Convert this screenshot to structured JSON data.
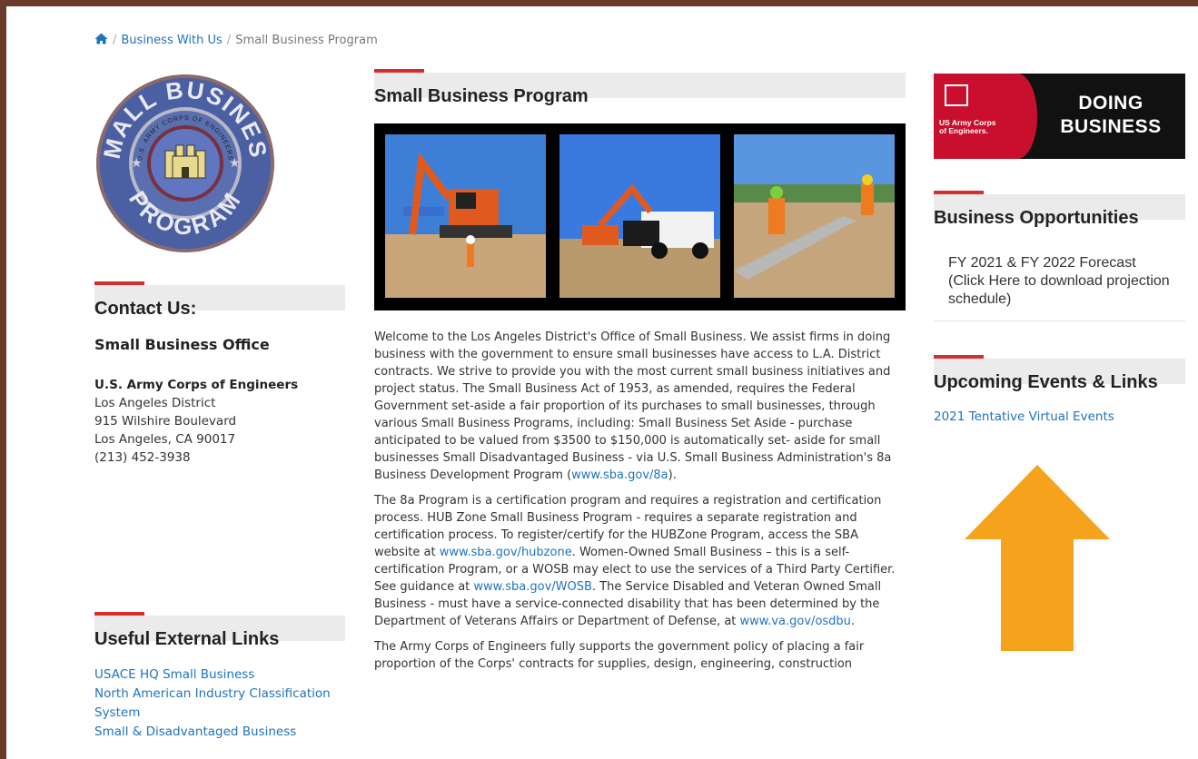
{
  "breadcrumb": {
    "home_icon": "home-icon",
    "items": [
      "Business With Us",
      "Small Business Program"
    ],
    "separator": "/"
  },
  "seal": {
    "top_text": "SMALL BUSINESS",
    "bottom_text": "PROGRAM",
    "ring_text": "U.S. ARMY CORPS OF ENGINEERS"
  },
  "contact": {
    "heading": "Contact Us:",
    "office": "Small Business Office",
    "org": "U.S. Army Corps of Engineers",
    "district": "Los Angeles District",
    "street": "915 Wilshire Boulevard",
    "city": "Los Angeles, CA 90017",
    "phone": "(213) 452-3938"
  },
  "useful_links": {
    "heading": "Useful External Links",
    "items": [
      "USACE HQ Small Business",
      "North American Industry Classification",
      "System",
      "Small & Disadvantaged Business"
    ]
  },
  "main": {
    "title": "Small Business Program",
    "p1_text": "Welcome to the Los Angeles District's Office of Small Business. We assist firms in doing business with the government to ensure small businesses have access to L.A. District contracts. We strive to provide you with the most current small business initiatives and project status. The Small Business Act of 1953, as amended, requires the Federal Government set-aside a fair proportion of its purchases to small businesses, through various Small Business Programs, including: Small Business Set Aside - purchase anticipated to be valued from $3500 to $150,000 is automatically set- aside for small businesses Small Disadvantaged Business - via U.S. Small Business Administration's 8a Business Development Program (",
    "p1_link": "www.sba.gov/8a",
    "p1_end": ").",
    "p2_a": "The 8a Program is a certification program and requires a registration and certification process. HUB Zone Small Business Program - requires a separate registration and certification process. To register/certify for the HUBZone Program, access the SBA website at ",
    "p2_link1": "www.sba.gov/hubzone",
    "p2_b": ". Women-Owned Small Business – this is a self- certification Program, or a WOSB may elect to use the services of a Third Party Certifier. See guidance at ",
    "p2_link2": "www.sba.gov/WOSB",
    "p2_c": ". The Service Disabled and Veteran Owned Small Business - must have a service-connected disability that has been determined by the Department of Veterans Affairs or Department of Defense, at ",
    "p2_link3": "www.va.gov/osdbu",
    "p2_d": ".",
    "p3_text": "The Army Corps of Engineers fully supports the government policy of placing a fair proportion of the Corps' contracts for supplies, design, engineering, construction"
  },
  "banner": {
    "org_line1": "US Army Corps",
    "org_line2": "of Engineers.",
    "doing": "DOING",
    "business": "BUSINESS"
  },
  "opportunities": {
    "heading": "Business Opportunities",
    "item": "FY 2021 & FY 2022 Forecast (Click Here to download projection schedule)"
  },
  "events": {
    "heading": "Upcoming Events & Links",
    "link": "2021 Tentative Virtual Events"
  },
  "colors": {
    "accent_red": "#d32f2f",
    "link_blue": "#1e73be",
    "arrow_orange": "#f5a31d",
    "frame_brown": "#6b3a2a"
  }
}
